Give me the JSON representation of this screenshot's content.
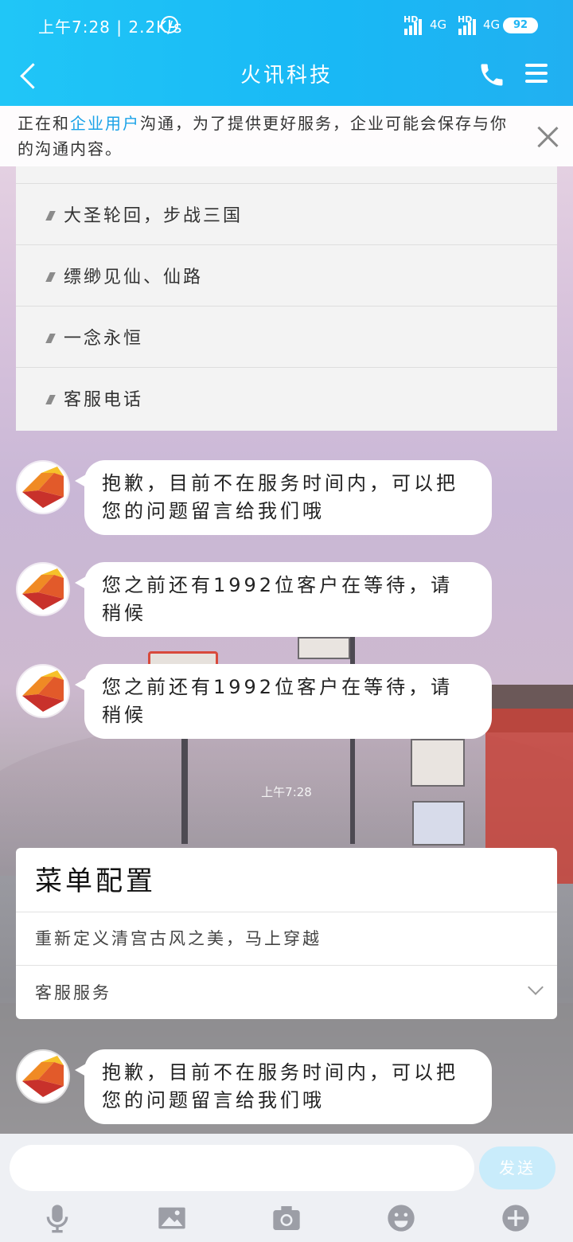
{
  "status_bar": {
    "time": "上午7:28 | 2.2K/s",
    "network_1": "4G",
    "network_2": "4G",
    "hd_1": "HD",
    "hd_2": "HD",
    "battery": "92"
  },
  "header": {
    "title": "火讯科技"
  },
  "notice": {
    "prefix": "正在和",
    "highlight": "企业用户",
    "suffix": "沟通，为了提供更好服务，企业可能会保存与你的沟通内容。"
  },
  "menu_list": {
    "items": [
      {
        "label": "大圣轮回，步战三国"
      },
      {
        "label": "缥缈见仙、仙路"
      },
      {
        "label": "一念永恒"
      },
      {
        "label": "客服电话"
      }
    ]
  },
  "messages": [
    {
      "text": "抱歉，目前不在服务时间内，可以把您的问题留言给我们哦"
    },
    {
      "text": "您之前还有1992位客户在等待，请稍候"
    },
    {
      "text": "您之前还有1992位客户在等待，请稍候"
    },
    {
      "text": "抱歉，目前不在服务时间内，可以把您的问题留言给我们哦"
    }
  ],
  "timestamp": "上午7:28",
  "menu_config": {
    "title": "菜单配置",
    "description": "重新定义清宫古风之美，马上穿越",
    "option": "客服服务"
  },
  "input": {
    "placeholder": "",
    "send_label": "发送"
  },
  "toolbar_icons": [
    "microphone-icon",
    "image-icon",
    "camera-icon",
    "emoji-icon",
    "plus-icon"
  ],
  "colors": {
    "header": "#19b8f5",
    "highlight": "#1aa2e8",
    "send_button": "#c9ecfb"
  }
}
